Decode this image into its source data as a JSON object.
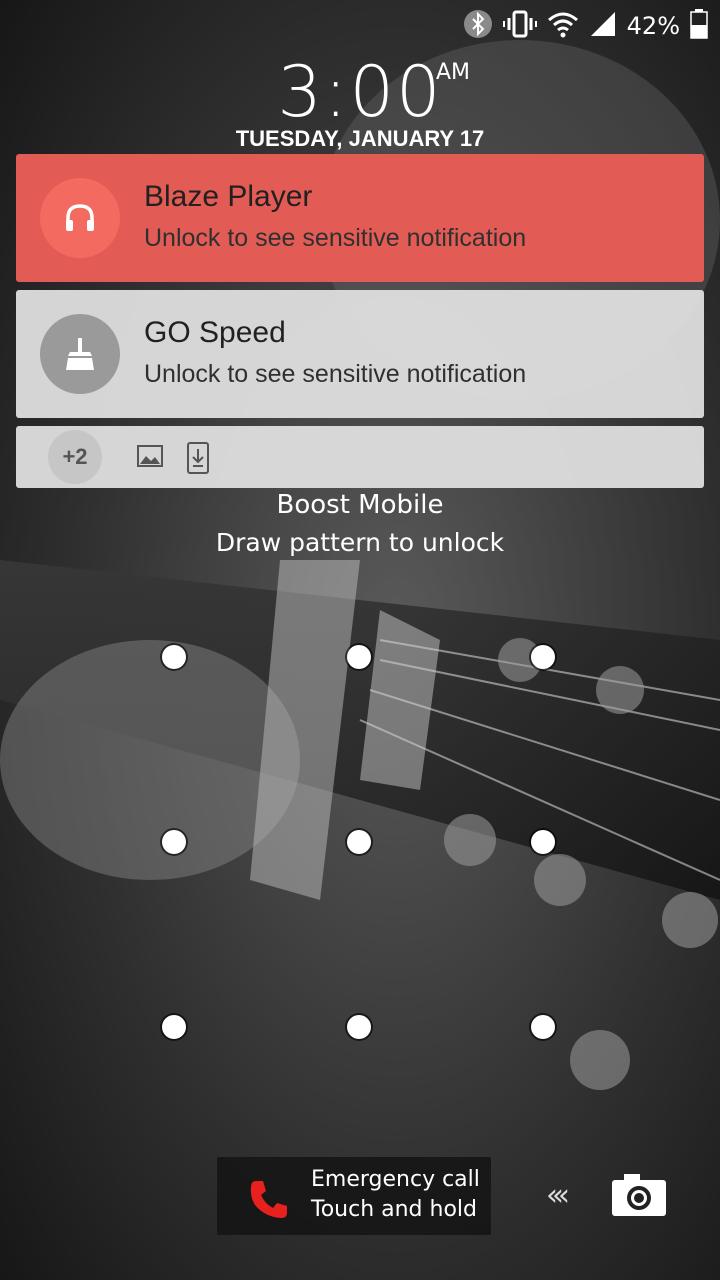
{
  "status_bar": {
    "icons": [
      "bluetooth-icon",
      "vibrate-icon",
      "wifi-icon",
      "signal-icon",
      "battery-icon"
    ],
    "battery_percent": "42%"
  },
  "lockscreen": {
    "time": "3:00",
    "ampm": "AM",
    "date": "TUESDAY, JANUARY 17",
    "carrier": "Boost Mobile",
    "instruction": "Draw pattern to unlock"
  },
  "notifications": [
    {
      "app": "Blaze Player",
      "text": "Unlock to see sensitive notification",
      "icon": "headphones-icon",
      "color": "#e25c55"
    },
    {
      "app": "GO Speed",
      "text": "Unlock to see sensitive notification",
      "icon": "broom-icon",
      "color": "#9a9a9a"
    }
  ],
  "overflow": {
    "count": "+2",
    "icons": [
      "image-icon",
      "download-icon"
    ]
  },
  "pattern": {
    "rows": 3,
    "cols": 3
  },
  "emergency": {
    "line1": "Emergency call",
    "line2": "Touch and hold",
    "icon": "phone-icon",
    "color": "#e8201e"
  },
  "camera_shortcut": {
    "chevron": "‹‹‹",
    "icon": "camera-icon"
  }
}
